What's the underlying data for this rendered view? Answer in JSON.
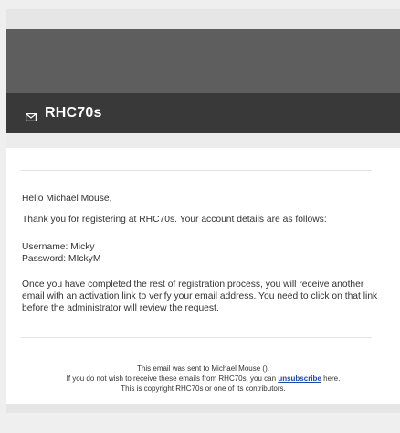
{
  "header": {
    "brand": "RHC70s",
    "icon": "mail-icon"
  },
  "email": {
    "greeting": "Hello Michael Mouse,",
    "intro": "Thank you for registering at RHC70s. Your account details are as follows:",
    "username_line": "Username: Micky",
    "password_line": "Password: MIckyM",
    "instructions": "Once you have completed the rest of registration process, you will receive another email with an activation link to verify your email address. You need to click on that link before the administrator will review the request."
  },
  "footer": {
    "sent_to": "This email was sent to Michael Mouse ().",
    "unsubscribe_prefix": "If you do not wish to receive these emails from RHC70s, you can ",
    "unsubscribe_link": "unsubscribe",
    "unsubscribe_suffix": " here.",
    "copyright": "This is copyright RHC70s or one of its contributors."
  },
  "colors": {
    "header_band": "#5e5e5e",
    "brand_bar": "#393939",
    "link": "#1a4aa8"
  }
}
